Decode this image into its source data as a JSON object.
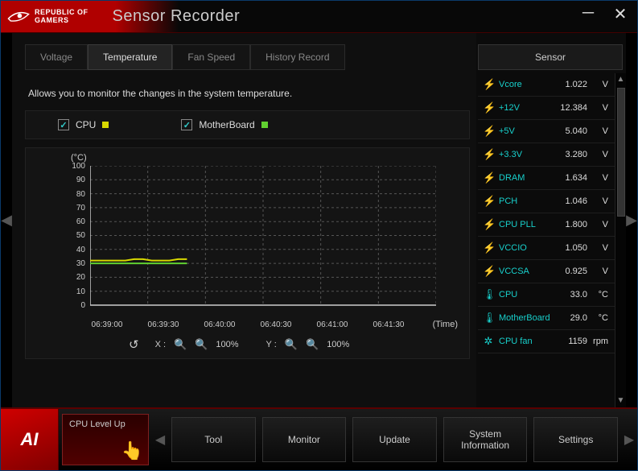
{
  "header": {
    "brand_top": "REPUBLIC OF",
    "brand_bottom": "GAMERS",
    "title": "Sensor Recorder"
  },
  "tabs": {
    "voltage": "Voltage",
    "temperature": "Temperature",
    "fan_speed": "Fan Speed",
    "history": "History Record",
    "active": "temperature"
  },
  "description": "Allows you to monitor the changes in the system temperature.",
  "series": {
    "cpu": {
      "label": "CPU",
      "checked": true,
      "color": "#d8d800"
    },
    "mb": {
      "label": "MotherBoard",
      "checked": true,
      "color": "#60d030"
    }
  },
  "chart_data": {
    "type": "line",
    "ylabel": "(°C)",
    "xlabel": "(Time)",
    "ylim": [
      0,
      100
    ],
    "y_ticks": [
      "100",
      "90",
      "80",
      "70",
      "60",
      "50",
      "40",
      "30",
      "20",
      "10",
      "0"
    ],
    "x_ticks": [
      "06:39:00",
      "06:39:30",
      "06:40:00",
      "06:40:30",
      "06:41:00",
      "06:41:30"
    ],
    "series": [
      {
        "name": "CPU",
        "color": "#d8d800",
        "values": [
          32,
          32,
          32,
          32,
          32,
          33,
          33,
          32,
          32,
          32,
          33,
          33
        ]
      },
      {
        "name": "MotherBoard",
        "color": "#60d030",
        "values": [
          30,
          30,
          30,
          30,
          30,
          30,
          30,
          30,
          30,
          30,
          30,
          30
        ]
      }
    ],
    "data_extent_frac": 0.28
  },
  "zoom": {
    "x_label": "X :",
    "y_label": "Y :",
    "x_pct": "100%",
    "y_pct": "100%"
  },
  "sidebar": {
    "title": "Sensor",
    "rows": [
      {
        "icon": "bolt",
        "name": "Vcore",
        "value": "1.022",
        "unit": "V"
      },
      {
        "icon": "bolt",
        "name": "+12V",
        "value": "12.384",
        "unit": "V"
      },
      {
        "icon": "bolt",
        "name": "+5V",
        "value": "5.040",
        "unit": "V"
      },
      {
        "icon": "bolt",
        "name": "+3.3V",
        "value": "3.280",
        "unit": "V"
      },
      {
        "icon": "bolt",
        "name": "DRAM",
        "value": "1.634",
        "unit": "V"
      },
      {
        "icon": "bolt",
        "name": "PCH",
        "value": "1.046",
        "unit": "V"
      },
      {
        "icon": "bolt",
        "name": "CPU PLL",
        "value": "1.800",
        "unit": "V"
      },
      {
        "icon": "bolt",
        "name": "VCCIO",
        "value": "1.050",
        "unit": "V"
      },
      {
        "icon": "bolt",
        "name": "VCCSA",
        "value": "0.925",
        "unit": "V"
      },
      {
        "icon": "temp",
        "name": "CPU",
        "value": "33.0",
        "unit": "°C"
      },
      {
        "icon": "temp",
        "name": "MotherBoard",
        "value": "29.0",
        "unit": "°C"
      },
      {
        "icon": "fan",
        "name": "CPU fan",
        "value": "1159",
        "unit": "rpm"
      }
    ]
  },
  "toolbar": {
    "logo": "AI",
    "primary": "CPU Level Up",
    "buttons": [
      "Tool",
      "Monitor",
      "Update",
      "System Information",
      "Settings"
    ]
  }
}
